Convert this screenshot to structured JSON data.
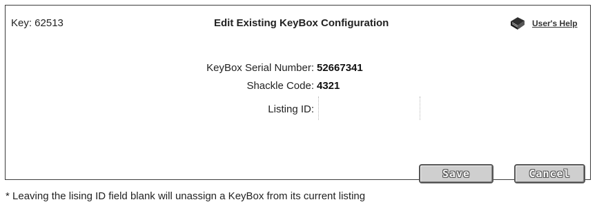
{
  "header": {
    "key_label": "Key: 62513",
    "title": "Edit Existing KeyBox Configuration",
    "help_link": "User's Help",
    "help_icon": "book-icon"
  },
  "form": {
    "serial_label": "KeyBox Serial Number:",
    "serial_value": "52667341",
    "shackle_label": "Shackle Code:",
    "shackle_value": "4321",
    "listing_label": "Listing ID:",
    "listing_value": ""
  },
  "buttons": {
    "save": "Save",
    "cancel": "Cancel"
  },
  "footnote": "* Leaving the lising ID field blank will unassign a KeyBox from its current listing",
  "colors": {
    "border": "#3a3a3a",
    "button_face": "#cfcfcf",
    "text": "#222222"
  }
}
